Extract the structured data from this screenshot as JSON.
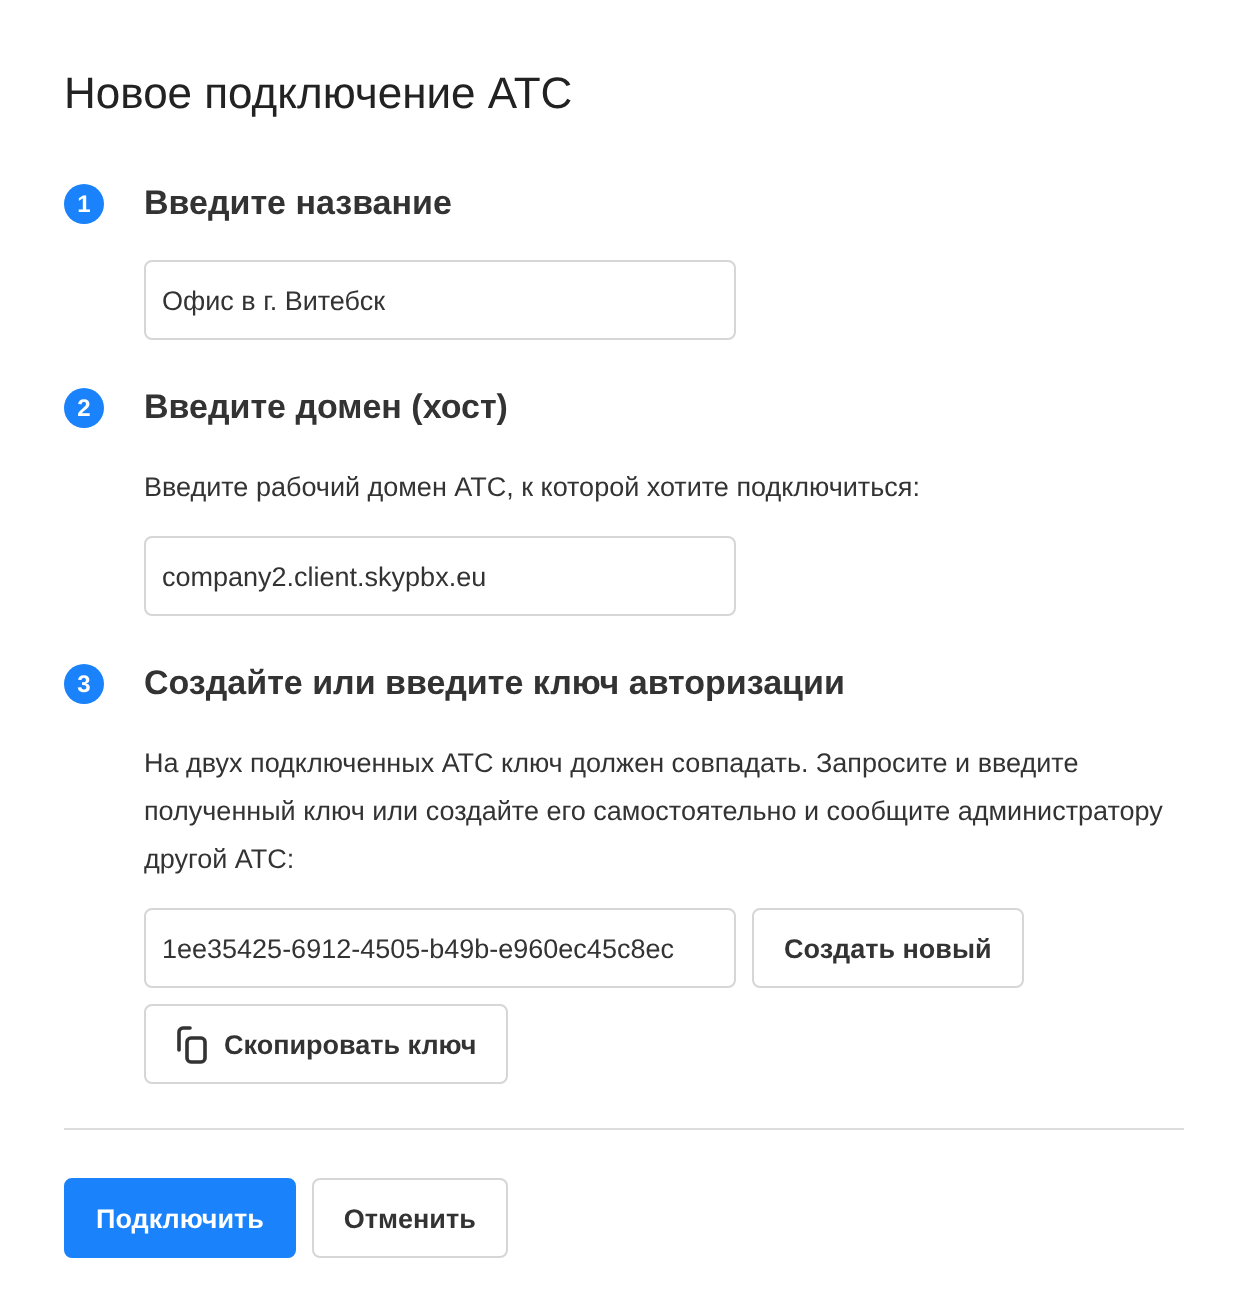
{
  "title": "Новое подключение АТС",
  "steps": [
    {
      "number": "1",
      "label": "Введите название",
      "field": {
        "value": "Офис в г. Витебск"
      }
    },
    {
      "number": "2",
      "label": "Введите домен (хост)",
      "description": "Введите рабочий домен АТС, к которой хотите подключиться:",
      "field": {
        "value": "company2.client.skypbx.eu"
      }
    },
    {
      "number": "3",
      "label": "Создайте или введите ключ авторизации",
      "description": "На двух подключенных АТС ключ должен совпадать. Запросите и введите полученный ключ или создайте его самостоятельно и сообщите администратору другой АТС:",
      "field": {
        "value": "1ee35425-6912-4505-b49b-e960ec45c8ec"
      },
      "side_button": {
        "label": "Создать новый"
      },
      "extra_button": {
        "kind": "copy",
        "label": "Скопировать ключ"
      }
    }
  ],
  "actions": [
    {
      "kind": "primary",
      "label": "Подключить"
    },
    {
      "kind": "secondary",
      "label": "Отменить"
    }
  ]
}
